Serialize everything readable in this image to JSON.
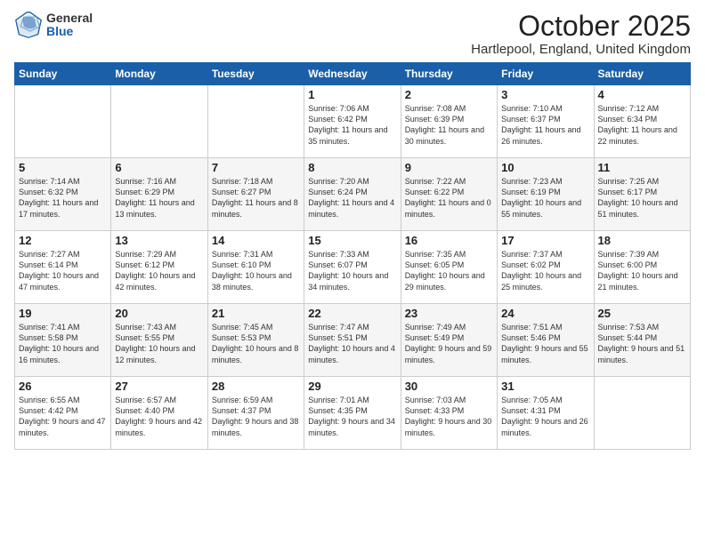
{
  "logo": {
    "general": "General",
    "blue": "Blue"
  },
  "header": {
    "month": "October 2025",
    "location": "Hartlepool, England, United Kingdom"
  },
  "weekdays": [
    "Sunday",
    "Monday",
    "Tuesday",
    "Wednesday",
    "Thursday",
    "Friday",
    "Saturday"
  ],
  "weeks": [
    [
      {
        "day": "",
        "sunrise": "",
        "sunset": "",
        "daylight": ""
      },
      {
        "day": "",
        "sunrise": "",
        "sunset": "",
        "daylight": ""
      },
      {
        "day": "",
        "sunrise": "",
        "sunset": "",
        "daylight": ""
      },
      {
        "day": "1",
        "sunrise": "Sunrise: 7:06 AM",
        "sunset": "Sunset: 6:42 PM",
        "daylight": "Daylight: 11 hours and 35 minutes."
      },
      {
        "day": "2",
        "sunrise": "Sunrise: 7:08 AM",
        "sunset": "Sunset: 6:39 PM",
        "daylight": "Daylight: 11 hours and 30 minutes."
      },
      {
        "day": "3",
        "sunrise": "Sunrise: 7:10 AM",
        "sunset": "Sunset: 6:37 PM",
        "daylight": "Daylight: 11 hours and 26 minutes."
      },
      {
        "day": "4",
        "sunrise": "Sunrise: 7:12 AM",
        "sunset": "Sunset: 6:34 PM",
        "daylight": "Daylight: 11 hours and 22 minutes."
      }
    ],
    [
      {
        "day": "5",
        "sunrise": "Sunrise: 7:14 AM",
        "sunset": "Sunset: 6:32 PM",
        "daylight": "Daylight: 11 hours and 17 minutes."
      },
      {
        "day": "6",
        "sunrise": "Sunrise: 7:16 AM",
        "sunset": "Sunset: 6:29 PM",
        "daylight": "Daylight: 11 hours and 13 minutes."
      },
      {
        "day": "7",
        "sunrise": "Sunrise: 7:18 AM",
        "sunset": "Sunset: 6:27 PM",
        "daylight": "Daylight: 11 hours and 8 minutes."
      },
      {
        "day": "8",
        "sunrise": "Sunrise: 7:20 AM",
        "sunset": "Sunset: 6:24 PM",
        "daylight": "Daylight: 11 hours and 4 minutes."
      },
      {
        "day": "9",
        "sunrise": "Sunrise: 7:22 AM",
        "sunset": "Sunset: 6:22 PM",
        "daylight": "Daylight: 11 hours and 0 minutes."
      },
      {
        "day": "10",
        "sunrise": "Sunrise: 7:23 AM",
        "sunset": "Sunset: 6:19 PM",
        "daylight": "Daylight: 10 hours and 55 minutes."
      },
      {
        "day": "11",
        "sunrise": "Sunrise: 7:25 AM",
        "sunset": "Sunset: 6:17 PM",
        "daylight": "Daylight: 10 hours and 51 minutes."
      }
    ],
    [
      {
        "day": "12",
        "sunrise": "Sunrise: 7:27 AM",
        "sunset": "Sunset: 6:14 PM",
        "daylight": "Daylight: 10 hours and 47 minutes."
      },
      {
        "day": "13",
        "sunrise": "Sunrise: 7:29 AM",
        "sunset": "Sunset: 6:12 PM",
        "daylight": "Daylight: 10 hours and 42 minutes."
      },
      {
        "day": "14",
        "sunrise": "Sunrise: 7:31 AM",
        "sunset": "Sunset: 6:10 PM",
        "daylight": "Daylight: 10 hours and 38 minutes."
      },
      {
        "day": "15",
        "sunrise": "Sunrise: 7:33 AM",
        "sunset": "Sunset: 6:07 PM",
        "daylight": "Daylight: 10 hours and 34 minutes."
      },
      {
        "day": "16",
        "sunrise": "Sunrise: 7:35 AM",
        "sunset": "Sunset: 6:05 PM",
        "daylight": "Daylight: 10 hours and 29 minutes."
      },
      {
        "day": "17",
        "sunrise": "Sunrise: 7:37 AM",
        "sunset": "Sunset: 6:02 PM",
        "daylight": "Daylight: 10 hours and 25 minutes."
      },
      {
        "day": "18",
        "sunrise": "Sunrise: 7:39 AM",
        "sunset": "Sunset: 6:00 PM",
        "daylight": "Daylight: 10 hours and 21 minutes."
      }
    ],
    [
      {
        "day": "19",
        "sunrise": "Sunrise: 7:41 AM",
        "sunset": "Sunset: 5:58 PM",
        "daylight": "Daylight: 10 hours and 16 minutes."
      },
      {
        "day": "20",
        "sunrise": "Sunrise: 7:43 AM",
        "sunset": "Sunset: 5:55 PM",
        "daylight": "Daylight: 10 hours and 12 minutes."
      },
      {
        "day": "21",
        "sunrise": "Sunrise: 7:45 AM",
        "sunset": "Sunset: 5:53 PM",
        "daylight": "Daylight: 10 hours and 8 minutes."
      },
      {
        "day": "22",
        "sunrise": "Sunrise: 7:47 AM",
        "sunset": "Sunset: 5:51 PM",
        "daylight": "Daylight: 10 hours and 4 minutes."
      },
      {
        "day": "23",
        "sunrise": "Sunrise: 7:49 AM",
        "sunset": "Sunset: 5:49 PM",
        "daylight": "Daylight: 9 hours and 59 minutes."
      },
      {
        "day": "24",
        "sunrise": "Sunrise: 7:51 AM",
        "sunset": "Sunset: 5:46 PM",
        "daylight": "Daylight: 9 hours and 55 minutes."
      },
      {
        "day": "25",
        "sunrise": "Sunrise: 7:53 AM",
        "sunset": "Sunset: 5:44 PM",
        "daylight": "Daylight: 9 hours and 51 minutes."
      }
    ],
    [
      {
        "day": "26",
        "sunrise": "Sunrise: 6:55 AM",
        "sunset": "Sunset: 4:42 PM",
        "daylight": "Daylight: 9 hours and 47 minutes."
      },
      {
        "day": "27",
        "sunrise": "Sunrise: 6:57 AM",
        "sunset": "Sunset: 4:40 PM",
        "daylight": "Daylight: 9 hours and 42 minutes."
      },
      {
        "day": "28",
        "sunrise": "Sunrise: 6:59 AM",
        "sunset": "Sunset: 4:37 PM",
        "daylight": "Daylight: 9 hours and 38 minutes."
      },
      {
        "day": "29",
        "sunrise": "Sunrise: 7:01 AM",
        "sunset": "Sunset: 4:35 PM",
        "daylight": "Daylight: 9 hours and 34 minutes."
      },
      {
        "day": "30",
        "sunrise": "Sunrise: 7:03 AM",
        "sunset": "Sunset: 4:33 PM",
        "daylight": "Daylight: 9 hours and 30 minutes."
      },
      {
        "day": "31",
        "sunrise": "Sunrise: 7:05 AM",
        "sunset": "Sunset: 4:31 PM",
        "daylight": "Daylight: 9 hours and 26 minutes."
      },
      {
        "day": "",
        "sunrise": "",
        "sunset": "",
        "daylight": ""
      }
    ]
  ]
}
